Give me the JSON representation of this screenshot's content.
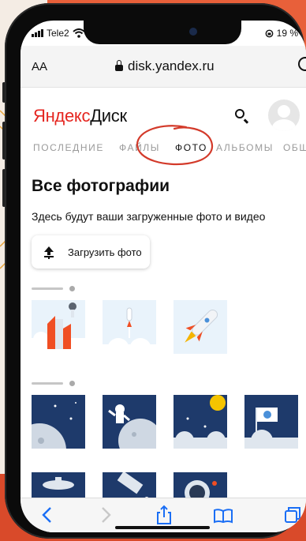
{
  "status": {
    "carrier": "Tele2",
    "battery": "19 %"
  },
  "browser": {
    "aa_label": "AA",
    "url": "disk.yandex.ru"
  },
  "header": {
    "logo_brand": "Яндекс",
    "logo_product": "Диск"
  },
  "tabs": [
    {
      "label": "ПОСЛЕДНИЕ"
    },
    {
      "label": "ФАЙЛЫ"
    },
    {
      "label": "ФОТО",
      "active": true
    },
    {
      "label": "АЛЬБОМЫ"
    },
    {
      "label": "ОБЩ"
    }
  ],
  "main": {
    "title": "Все фотографии",
    "subtitle": "Здесь будут ваши загруженные фото и видео",
    "upload_label": "Загрузить фото"
  },
  "colors": {
    "brand_red": "#e52620",
    "annotation": "#d33a2a",
    "ios_blue": "#1a6ef5"
  },
  "toolbar": {
    "icons": [
      "back-icon",
      "forward-icon",
      "share-icon",
      "bookmarks-icon",
      "tabs-icon"
    ]
  }
}
